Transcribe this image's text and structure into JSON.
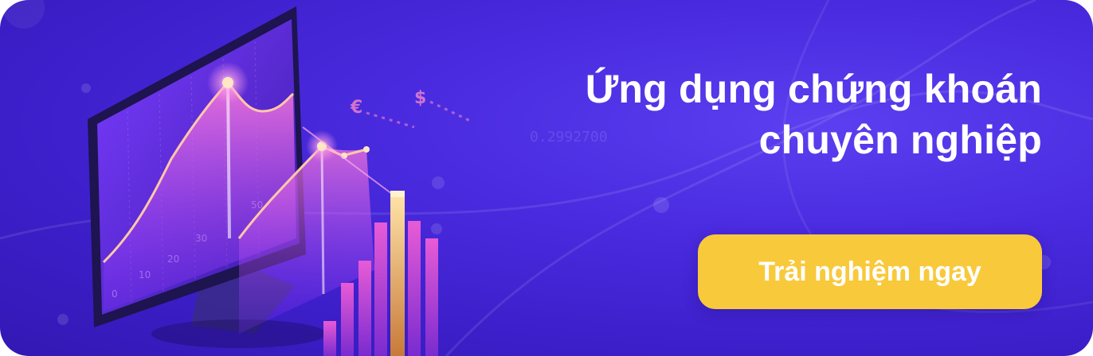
{
  "banner": {
    "headline_line1": "Ứng dụng chứng khoán",
    "headline_line2": "chuyên nghiệp",
    "cta_label": "Trải nghiệm ngay"
  },
  "illustration": {
    "y_tick_labels": [
      "0",
      "10",
      "20",
      "30",
      "50"
    ],
    "currency_symbols": [
      "€",
      "$"
    ],
    "faint_number": "0.2992700"
  },
  "colors": {
    "background": "#4a2be0",
    "cta_background": "#f9c93c",
    "text": "#ffffff"
  }
}
